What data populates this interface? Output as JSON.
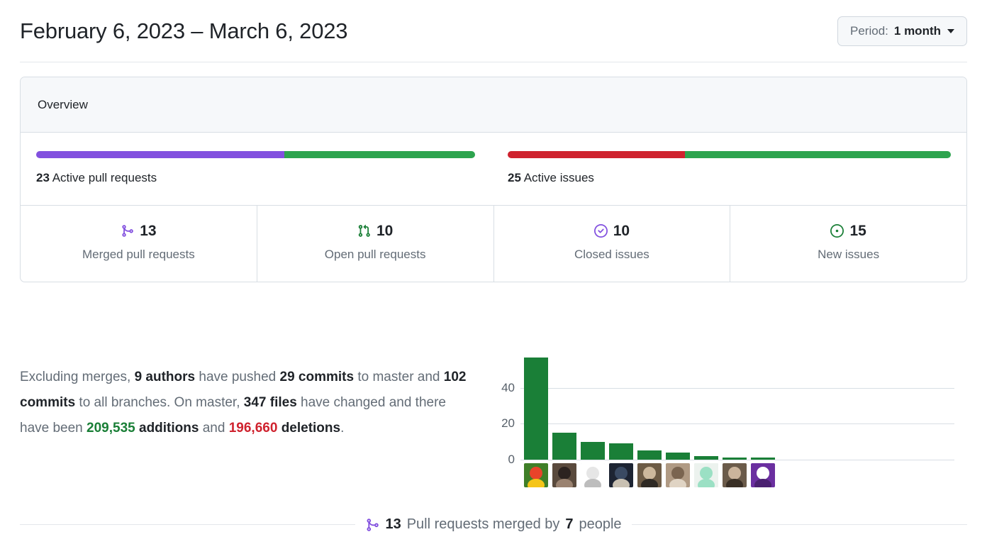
{
  "header": {
    "date_range": "February 6, 2023 – March 6, 2023",
    "period_button": {
      "prefix": "Period:",
      "value": "1 month",
      "caret_icon": "chevron-down-icon"
    }
  },
  "overview": {
    "title": "Overview",
    "pull_requests_bar": {
      "count": "23",
      "label": "Active pull requests",
      "segments": [
        {
          "name": "merged",
          "value": 13,
          "color": "#8250df"
        },
        {
          "name": "open",
          "value": 10,
          "color": "#2da44e"
        }
      ],
      "total": 23
    },
    "issues_bar": {
      "count": "25",
      "label": "Active issues",
      "segments": [
        {
          "name": "closed",
          "value": 10,
          "color": "#cf222e"
        },
        {
          "name": "new",
          "value": 15,
          "color": "#2da44e"
        }
      ],
      "total": 25
    },
    "stats": [
      {
        "icon": "git-merge-icon",
        "icon_color": "#8250df",
        "value": "13",
        "label": "Merged pull requests"
      },
      {
        "icon": "git-pull-request-icon",
        "icon_color": "#1a7f37",
        "value": "10",
        "label": "Open pull requests"
      },
      {
        "icon": "issue-closed-icon",
        "icon_color": "#8250df",
        "value": "10",
        "label": "Closed issues"
      },
      {
        "icon": "issue-opened-icon",
        "icon_color": "#1a7f37",
        "value": "15",
        "label": "New issues"
      }
    ]
  },
  "commits_summary": {
    "lead": "Excluding merges,",
    "authors": "9 authors",
    "mid1": "have pushed",
    "commits_master": "29 commits",
    "mid2": "to master and",
    "commits_all": "102 commits",
    "mid3": "to all branches. On master,",
    "files_changed": "347 files",
    "mid4": "have changed and there have been",
    "additions_count": "209,535",
    "additions_word": "additions",
    "mid5": "and",
    "deletions_count": "196,660",
    "deletions_word": "deletions",
    "tail": "."
  },
  "chart_data": {
    "type": "bar",
    "title": "",
    "xlabel": "",
    "ylabel": "",
    "categories": [
      "author-1-parrot",
      "author-2-portrait",
      "author-3-sketch",
      "author-4-photo",
      "author-5-portrait",
      "author-6-animal",
      "author-7-android",
      "author-8-portrait",
      "author-9-wolf-logo"
    ],
    "values": [
      57,
      15,
      10,
      9,
      5,
      4,
      2,
      1,
      1
    ],
    "ytick_labels": [
      "0",
      "20",
      "40"
    ],
    "ytick_values": [
      0,
      20,
      40
    ],
    "ylim": [
      0,
      60
    ],
    "grid": true,
    "legend": "none",
    "bar_color": "#1a7f37",
    "gridline_color": "#d8dee4",
    "tick_color": "#57606a"
  },
  "merged_footer": {
    "icon": "git-merge-icon",
    "icon_color": "#8250df",
    "count": "13",
    "mid": "Pull requests merged by",
    "people": "7",
    "tail": "people"
  }
}
